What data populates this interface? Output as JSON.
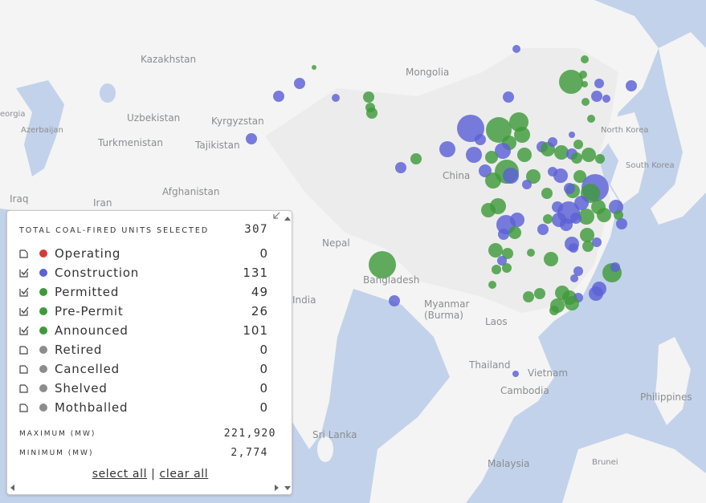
{
  "map": {
    "labels": [
      {
        "text": "Kazakhstan"
      },
      {
        "text": "Mongolia"
      },
      {
        "text": "Uzbekistan"
      },
      {
        "text": "Kyrgyzstan"
      },
      {
        "text": "Turkmenistan"
      },
      {
        "text": "Tajikistan"
      },
      {
        "text": "Azerbaijan"
      },
      {
        "text": "eorgia"
      },
      {
        "text": "Afghanistan"
      },
      {
        "text": "Iraq"
      },
      {
        "text": "Iran"
      },
      {
        "text": "China"
      },
      {
        "text": "North Korea"
      },
      {
        "text": "South Korea"
      },
      {
        "text": "Nepal"
      },
      {
        "text": "Bangladesh"
      },
      {
        "text": "India"
      },
      {
        "text": "Myanmar\n(Burma)"
      },
      {
        "text": "Laos"
      },
      {
        "text": "Thailand"
      },
      {
        "text": "Vietnam"
      },
      {
        "text": "Cambodia"
      },
      {
        "text": "Philippines"
      },
      {
        "text": "Sri Lanka"
      },
      {
        "text": "Malaysia"
      },
      {
        "text": "Brunei"
      }
    ],
    "colors": {
      "construction": "#5c60d6",
      "preconstruction": "#3f9a3c"
    }
  },
  "panel": {
    "total_label": "TOTAL COAL-FIRED UNITS SELECTED",
    "total_value": "307",
    "statuses": [
      {
        "label": "Operating",
        "count": "0",
        "checked": false,
        "color": "#d43c3c"
      },
      {
        "label": "Construction",
        "count": "131",
        "checked": true,
        "color": "#5c60d6"
      },
      {
        "label": "Permitted",
        "count": "49",
        "checked": true,
        "color": "#3f9a3c"
      },
      {
        "label": "Pre-Permit",
        "count": "26",
        "checked": true,
        "color": "#3f9a3c"
      },
      {
        "label": "Announced",
        "count": "101",
        "checked": true,
        "color": "#3f9a3c"
      },
      {
        "label": "Retired",
        "count": "0",
        "checked": false,
        "color": "#8c8c8c"
      },
      {
        "label": "Cancelled",
        "count": "0",
        "checked": false,
        "color": "#8c8c8c"
      },
      {
        "label": "Shelved",
        "count": "0",
        "checked": false,
        "color": "#8c8c8c"
      },
      {
        "label": "Mothballed",
        "count": "0",
        "checked": false,
        "color": "#8c8c8c"
      }
    ],
    "max_label": "MAXIMUM (MW)",
    "max_value": "221,920",
    "min_label": "MINIMUM (MW)",
    "min_value": "2,774",
    "select_all": "select all",
    "separator": "|",
    "clear_all": "clear all"
  }
}
